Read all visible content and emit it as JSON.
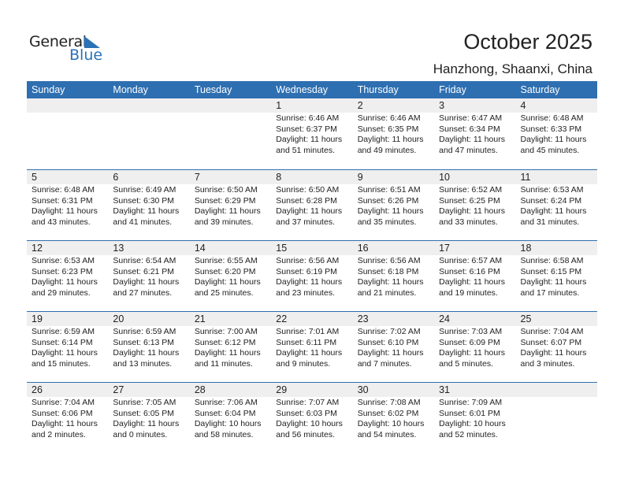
{
  "logo": {
    "word1": "General",
    "word2": "Blue"
  },
  "header": {
    "title": "October 2025",
    "location": "Hanzhong, Shaanxi, China"
  },
  "colors": {
    "accent": "#2e6fb1",
    "day_strip": "#efefef",
    "logo_blue": "#2a72b8"
  },
  "weekdays": [
    "Sunday",
    "Monday",
    "Tuesday",
    "Wednesday",
    "Thursday",
    "Friday",
    "Saturday"
  ],
  "labels": {
    "sunrise": "Sunrise:",
    "sunset": "Sunset:",
    "daylight": "Daylight:"
  },
  "weeks": [
    [
      null,
      null,
      null,
      {
        "day": "1",
        "sunrise": "Sunrise: 6:46 AM",
        "sunset": "Sunset: 6:37 PM",
        "daylight": "Daylight: 11 hours",
        "minutes": "and 51 minutes."
      },
      {
        "day": "2",
        "sunrise": "Sunrise: 6:46 AM",
        "sunset": "Sunset: 6:35 PM",
        "daylight": "Daylight: 11 hours",
        "minutes": "and 49 minutes."
      },
      {
        "day": "3",
        "sunrise": "Sunrise: 6:47 AM",
        "sunset": "Sunset: 6:34 PM",
        "daylight": "Daylight: 11 hours",
        "minutes": "and 47 minutes."
      },
      {
        "day": "4",
        "sunrise": "Sunrise: 6:48 AM",
        "sunset": "Sunset: 6:33 PM",
        "daylight": "Daylight: 11 hours",
        "minutes": "and 45 minutes."
      }
    ],
    [
      {
        "day": "5",
        "sunrise": "Sunrise: 6:48 AM",
        "sunset": "Sunset: 6:31 PM",
        "daylight": "Daylight: 11 hours",
        "minutes": "and 43 minutes."
      },
      {
        "day": "6",
        "sunrise": "Sunrise: 6:49 AM",
        "sunset": "Sunset: 6:30 PM",
        "daylight": "Daylight: 11 hours",
        "minutes": "and 41 minutes."
      },
      {
        "day": "7",
        "sunrise": "Sunrise: 6:50 AM",
        "sunset": "Sunset: 6:29 PM",
        "daylight": "Daylight: 11 hours",
        "minutes": "and 39 minutes."
      },
      {
        "day": "8",
        "sunrise": "Sunrise: 6:50 AM",
        "sunset": "Sunset: 6:28 PM",
        "daylight": "Daylight: 11 hours",
        "minutes": "and 37 minutes."
      },
      {
        "day": "9",
        "sunrise": "Sunrise: 6:51 AM",
        "sunset": "Sunset: 6:26 PM",
        "daylight": "Daylight: 11 hours",
        "minutes": "and 35 minutes."
      },
      {
        "day": "10",
        "sunrise": "Sunrise: 6:52 AM",
        "sunset": "Sunset: 6:25 PM",
        "daylight": "Daylight: 11 hours",
        "minutes": "and 33 minutes."
      },
      {
        "day": "11",
        "sunrise": "Sunrise: 6:53 AM",
        "sunset": "Sunset: 6:24 PM",
        "daylight": "Daylight: 11 hours",
        "minutes": "and 31 minutes."
      }
    ],
    [
      {
        "day": "12",
        "sunrise": "Sunrise: 6:53 AM",
        "sunset": "Sunset: 6:23 PM",
        "daylight": "Daylight: 11 hours",
        "minutes": "and 29 minutes."
      },
      {
        "day": "13",
        "sunrise": "Sunrise: 6:54 AM",
        "sunset": "Sunset: 6:21 PM",
        "daylight": "Daylight: 11 hours",
        "minutes": "and 27 minutes."
      },
      {
        "day": "14",
        "sunrise": "Sunrise: 6:55 AM",
        "sunset": "Sunset: 6:20 PM",
        "daylight": "Daylight: 11 hours",
        "minutes": "and 25 minutes."
      },
      {
        "day": "15",
        "sunrise": "Sunrise: 6:56 AM",
        "sunset": "Sunset: 6:19 PM",
        "daylight": "Daylight: 11 hours",
        "minutes": "and 23 minutes."
      },
      {
        "day": "16",
        "sunrise": "Sunrise: 6:56 AM",
        "sunset": "Sunset: 6:18 PM",
        "daylight": "Daylight: 11 hours",
        "minutes": "and 21 minutes."
      },
      {
        "day": "17",
        "sunrise": "Sunrise: 6:57 AM",
        "sunset": "Sunset: 6:16 PM",
        "daylight": "Daylight: 11 hours",
        "minutes": "and 19 minutes."
      },
      {
        "day": "18",
        "sunrise": "Sunrise: 6:58 AM",
        "sunset": "Sunset: 6:15 PM",
        "daylight": "Daylight: 11 hours",
        "minutes": "and 17 minutes."
      }
    ],
    [
      {
        "day": "19",
        "sunrise": "Sunrise: 6:59 AM",
        "sunset": "Sunset: 6:14 PM",
        "daylight": "Daylight: 11 hours",
        "minutes": "and 15 minutes."
      },
      {
        "day": "20",
        "sunrise": "Sunrise: 6:59 AM",
        "sunset": "Sunset: 6:13 PM",
        "daylight": "Daylight: 11 hours",
        "minutes": "and 13 minutes."
      },
      {
        "day": "21",
        "sunrise": "Sunrise: 7:00 AM",
        "sunset": "Sunset: 6:12 PM",
        "daylight": "Daylight: 11 hours",
        "minutes": "and 11 minutes."
      },
      {
        "day": "22",
        "sunrise": "Sunrise: 7:01 AM",
        "sunset": "Sunset: 6:11 PM",
        "daylight": "Daylight: 11 hours",
        "minutes": "and 9 minutes."
      },
      {
        "day": "23",
        "sunrise": "Sunrise: 7:02 AM",
        "sunset": "Sunset: 6:10 PM",
        "daylight": "Daylight: 11 hours",
        "minutes": "and 7 minutes."
      },
      {
        "day": "24",
        "sunrise": "Sunrise: 7:03 AM",
        "sunset": "Sunset: 6:09 PM",
        "daylight": "Daylight: 11 hours",
        "minutes": "and 5 minutes."
      },
      {
        "day": "25",
        "sunrise": "Sunrise: 7:04 AM",
        "sunset": "Sunset: 6:07 PM",
        "daylight": "Daylight: 11 hours",
        "minutes": "and 3 minutes."
      }
    ],
    [
      {
        "day": "26",
        "sunrise": "Sunrise: 7:04 AM",
        "sunset": "Sunset: 6:06 PM",
        "daylight": "Daylight: 11 hours",
        "minutes": "and 2 minutes."
      },
      {
        "day": "27",
        "sunrise": "Sunrise: 7:05 AM",
        "sunset": "Sunset: 6:05 PM",
        "daylight": "Daylight: 11 hours",
        "minutes": "and 0 minutes."
      },
      {
        "day": "28",
        "sunrise": "Sunrise: 7:06 AM",
        "sunset": "Sunset: 6:04 PM",
        "daylight": "Daylight: 10 hours",
        "minutes": "and 58 minutes."
      },
      {
        "day": "29",
        "sunrise": "Sunrise: 7:07 AM",
        "sunset": "Sunset: 6:03 PM",
        "daylight": "Daylight: 10 hours",
        "minutes": "and 56 minutes."
      },
      {
        "day": "30",
        "sunrise": "Sunrise: 7:08 AM",
        "sunset": "Sunset: 6:02 PM",
        "daylight": "Daylight: 10 hours",
        "minutes": "and 54 minutes."
      },
      {
        "day": "31",
        "sunrise": "Sunrise: 7:09 AM",
        "sunset": "Sunset: 6:01 PM",
        "daylight": "Daylight: 10 hours",
        "minutes": "and 52 minutes."
      },
      null
    ]
  ]
}
